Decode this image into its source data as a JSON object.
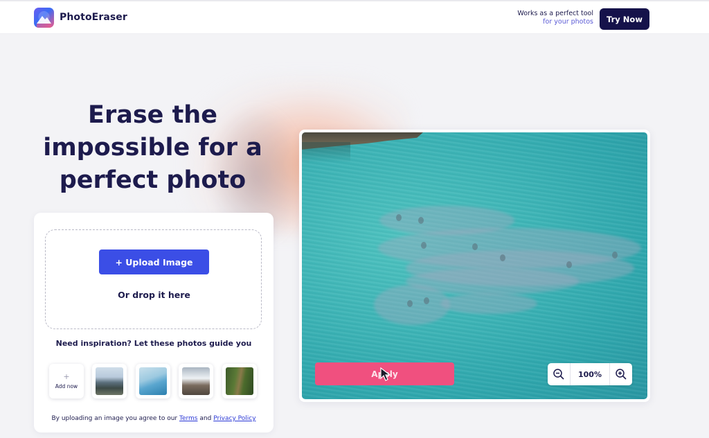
{
  "header": {
    "brand": "PhotoEraser",
    "tagline_line1": "Works as a perfect tool",
    "tagline_line2": "for your photos",
    "try_now": "Try Now"
  },
  "hero": {
    "line1": "Erase the",
    "line2": "impossible for a",
    "line3": "perfect photo"
  },
  "upload": {
    "button": "+ Upload Image",
    "drop_text": "Or drop it here",
    "inspiration": "Need inspiration? Let these photos guide you",
    "add_plus": "+",
    "add_now": "Add now",
    "terms_prefix": "By uploading an image you agree to our",
    "terms_link": "Terms",
    "terms_and": "and",
    "privacy_link": "Privacy Policy"
  },
  "editor": {
    "apply": "Apply",
    "zoom_value": "100%"
  },
  "colors": {
    "brand_dark": "#15124a",
    "upload_blue": "#3b4ee6",
    "apply_pink": "#f0507f"
  },
  "icons": {
    "logo": "mountain-logo-icon",
    "zoom_out": "zoom-out-icon",
    "zoom_in": "zoom-in-icon",
    "cursor": "mouse-cursor-icon"
  }
}
